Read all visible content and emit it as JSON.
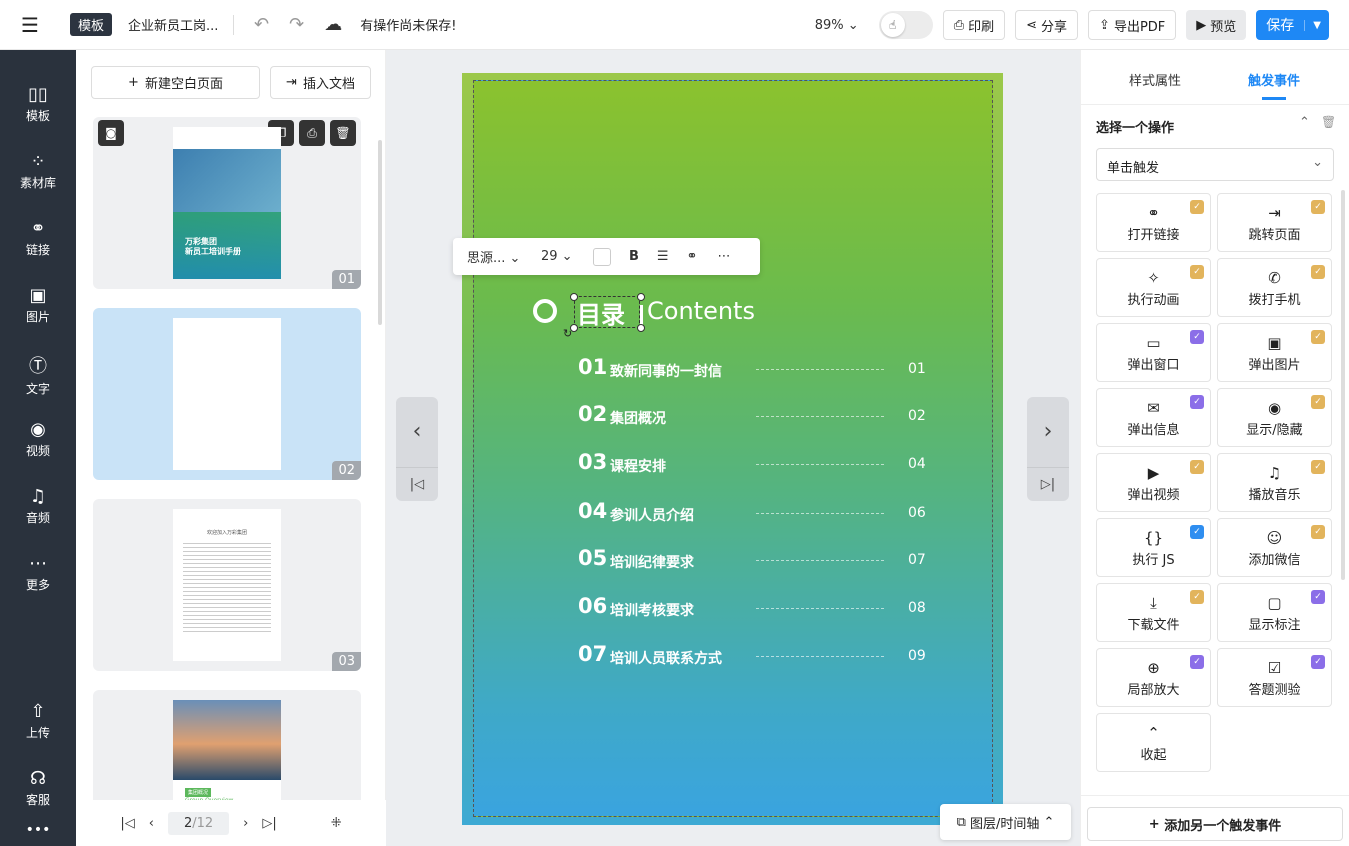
{
  "topbar": {
    "template_tag": "模板",
    "doc_title": "企业新员工岗...",
    "unsaved_text": "有操作尚未保存!",
    "zoom": "89%",
    "print": "印刷",
    "share": "分享",
    "export_pdf": "导出PDF",
    "preview": "预览",
    "save": "保存"
  },
  "leftnav": [
    {
      "icon": "template-icon",
      "label": "模板"
    },
    {
      "icon": "materials-icon",
      "label": "素材库"
    },
    {
      "icon": "link-icon",
      "label": "链接"
    },
    {
      "icon": "image-icon",
      "label": "图片"
    },
    {
      "icon": "text-icon",
      "label": "文字"
    },
    {
      "icon": "video-icon",
      "label": "视频"
    },
    {
      "icon": "audio-icon",
      "label": "音频"
    },
    {
      "icon": "more-icon",
      "label": "更多"
    },
    {
      "icon": "upload-icon",
      "label": "上传"
    },
    {
      "icon": "support-icon",
      "label": "客服"
    }
  ],
  "pages_panel": {
    "new_blank": "新建空白页面",
    "insert_doc": "插入文档",
    "thumbs": [
      {
        "num": "01",
        "cover_line1": "万彩集团",
        "cover_line2": "新员工培训手册"
      },
      {
        "num": "02"
      },
      {
        "num": "03",
        "letter_title": "欢迎加入万彩集团"
      },
      {
        "num": "",
        "overview_tag": "集团概况",
        "overview_en": "Group Overview"
      }
    ],
    "pager_current": "2",
    "pager_total": "/12"
  },
  "text_toolbar": {
    "font": "思源...",
    "size": "29"
  },
  "slide": {
    "heading_cn": "目录",
    "heading_en": "Contents",
    "toc": [
      {
        "n": "01",
        "t": "致新同事的一封信",
        "p": "01"
      },
      {
        "n": "02",
        "t": "集团概况",
        "p": "02"
      },
      {
        "n": "03",
        "t": "课程安排",
        "p": "04"
      },
      {
        "n": "04",
        "t": "参训人员介绍",
        "p": "06"
      },
      {
        "n": "05",
        "t": "培训纪律要求",
        "p": "07"
      },
      {
        "n": "06",
        "t": "培训考核要求",
        "p": "08"
      },
      {
        "n": "07",
        "t": "培训人员联系方式",
        "p": "09"
      }
    ]
  },
  "layers_btn": "图层/时间轴",
  "right_panel": {
    "tab_style": "样式属性",
    "tab_events": "触发事件",
    "section_title": "选择一个操作",
    "trigger_select": "单击触发",
    "actions": [
      {
        "icon": "link-icon",
        "label": "打开链接",
        "badge": "gold"
      },
      {
        "icon": "jump-page-icon",
        "label": "跳转页面",
        "badge": "gold"
      },
      {
        "icon": "sparkle-icon",
        "label": "执行动画",
        "badge": "gold"
      },
      {
        "icon": "phone-icon",
        "label": "拨打手机",
        "badge": "gold"
      },
      {
        "icon": "window-icon",
        "label": "弹出窗口",
        "badge": "purple"
      },
      {
        "icon": "image-icon",
        "label": "弹出图片",
        "badge": "gold"
      },
      {
        "icon": "mail-icon",
        "label": "弹出信息",
        "badge": "purple"
      },
      {
        "icon": "eye-icon",
        "label": "显示/隐藏",
        "badge": "gold"
      },
      {
        "icon": "play-icon",
        "label": "弹出视频",
        "badge": "gold"
      },
      {
        "icon": "music-icon",
        "label": "播放音乐",
        "badge": "gold"
      },
      {
        "icon": "code-icon",
        "label": "执行 JS",
        "badge": "blue"
      },
      {
        "icon": "wechat-icon",
        "label": "添加微信",
        "badge": "gold"
      },
      {
        "icon": "download-icon",
        "label": "下载文件",
        "badge": "gold"
      },
      {
        "icon": "annotation-icon",
        "label": "显示标注",
        "badge": "purple"
      },
      {
        "icon": "zoom-icon",
        "label": "局部放大",
        "badge": "purple"
      },
      {
        "icon": "quiz-icon",
        "label": "答题测验",
        "badge": "purple"
      },
      {
        "icon": "collapse-icon",
        "label": "收起",
        "badge": ""
      }
    ],
    "add_event": "添加另一个触发事件"
  },
  "colors": {
    "accent": "#1e88f5",
    "nav_bg": "#2a323d",
    "badge_gold": "#e2b45c",
    "badge_purple": "#8b6ee8",
    "badge_blue": "#2f8ef0"
  }
}
